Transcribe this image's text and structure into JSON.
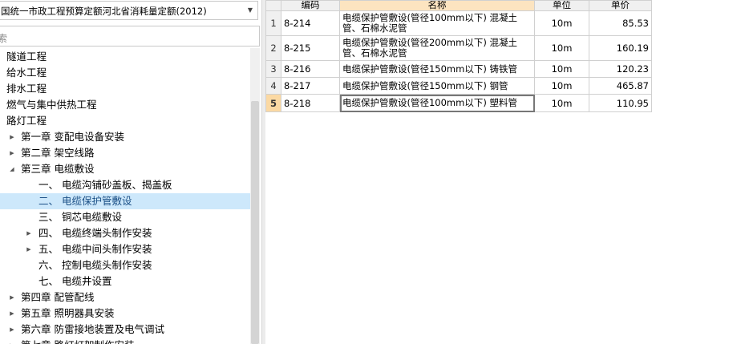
{
  "library": {
    "selected": "国统一市政工程预算定额河北省消耗量定额(2012)",
    "arrow": "▼"
  },
  "search": {
    "placeholder": "索"
  },
  "tree": [
    {
      "label": "隧道工程",
      "level": 0,
      "toggle": ""
    },
    {
      "label": "给水工程",
      "level": 0,
      "toggle": ""
    },
    {
      "label": "排水工程",
      "level": 0,
      "toggle": ""
    },
    {
      "label": "燃气与集中供热工程",
      "level": 0,
      "toggle": ""
    },
    {
      "label": "路灯工程",
      "level": 0,
      "toggle": ""
    },
    {
      "label": "第一章  变配电设备安装",
      "level": 1,
      "toggle": "▶"
    },
    {
      "label": "第二章  架空线路",
      "level": 1,
      "toggle": "▶"
    },
    {
      "label": "第三章  电缆敷设",
      "level": 1,
      "toggle": "◢"
    },
    {
      "label": "一、  电缆沟铺砂盖板、揭盖板",
      "level": 2,
      "toggle": ""
    },
    {
      "label": "二、  电缆保护管敷设",
      "level": 2,
      "toggle": "",
      "selected": true
    },
    {
      "label": "三、  铜芯电缆敷设",
      "level": 2,
      "toggle": ""
    },
    {
      "label": "四、  电缆终端头制作安装",
      "level": 2,
      "toggle": "▶"
    },
    {
      "label": "五、  电缆中间头制作安装",
      "level": 2,
      "toggle": "▶"
    },
    {
      "label": "六、  控制电缆头制作安装",
      "level": 2,
      "toggle": ""
    },
    {
      "label": "七、  电缆井设置",
      "level": 2,
      "toggle": ""
    },
    {
      "label": "第四章  配管配线",
      "level": 1,
      "toggle": "▶"
    },
    {
      "label": "第五章  照明器具安装",
      "level": 1,
      "toggle": "▶"
    },
    {
      "label": "第六章  防雷接地装置及电气调试",
      "level": 1,
      "toggle": "▶"
    },
    {
      "label": "第七章  路灯灯架制作安装",
      "level": 1,
      "toggle": "▶"
    }
  ],
  "grid": {
    "headers": {
      "idx": "",
      "code": "编码",
      "name": "名称",
      "unit": "单位",
      "price": "单价"
    },
    "rows": [
      {
        "idx": "1",
        "code": "8-214",
        "name": "电缆保护管敷设(管径100mm以下) 混凝土管、石棉水泥管",
        "unit": "10m",
        "price": "85.53"
      },
      {
        "idx": "2",
        "code": "8-215",
        "name": "电缆保护管敷设(管径200mm以下) 混凝土管、石棉水泥管",
        "unit": "10m",
        "price": "160.19"
      },
      {
        "idx": "3",
        "code": "8-216",
        "name": "电缆保护管敷设(管径150mm以下) 铸铁管",
        "unit": "10m",
        "price": "120.23"
      },
      {
        "idx": "4",
        "code": "8-217",
        "name": "电缆保护管敷设(管径150mm以下) 钢管",
        "unit": "10m",
        "price": "465.87"
      },
      {
        "idx": "5",
        "code": "8-218",
        "name": "电缆保护管敷设(管径100mm以下) 塑料管",
        "unit": "10m",
        "price": "110.95",
        "current": true
      }
    ]
  }
}
